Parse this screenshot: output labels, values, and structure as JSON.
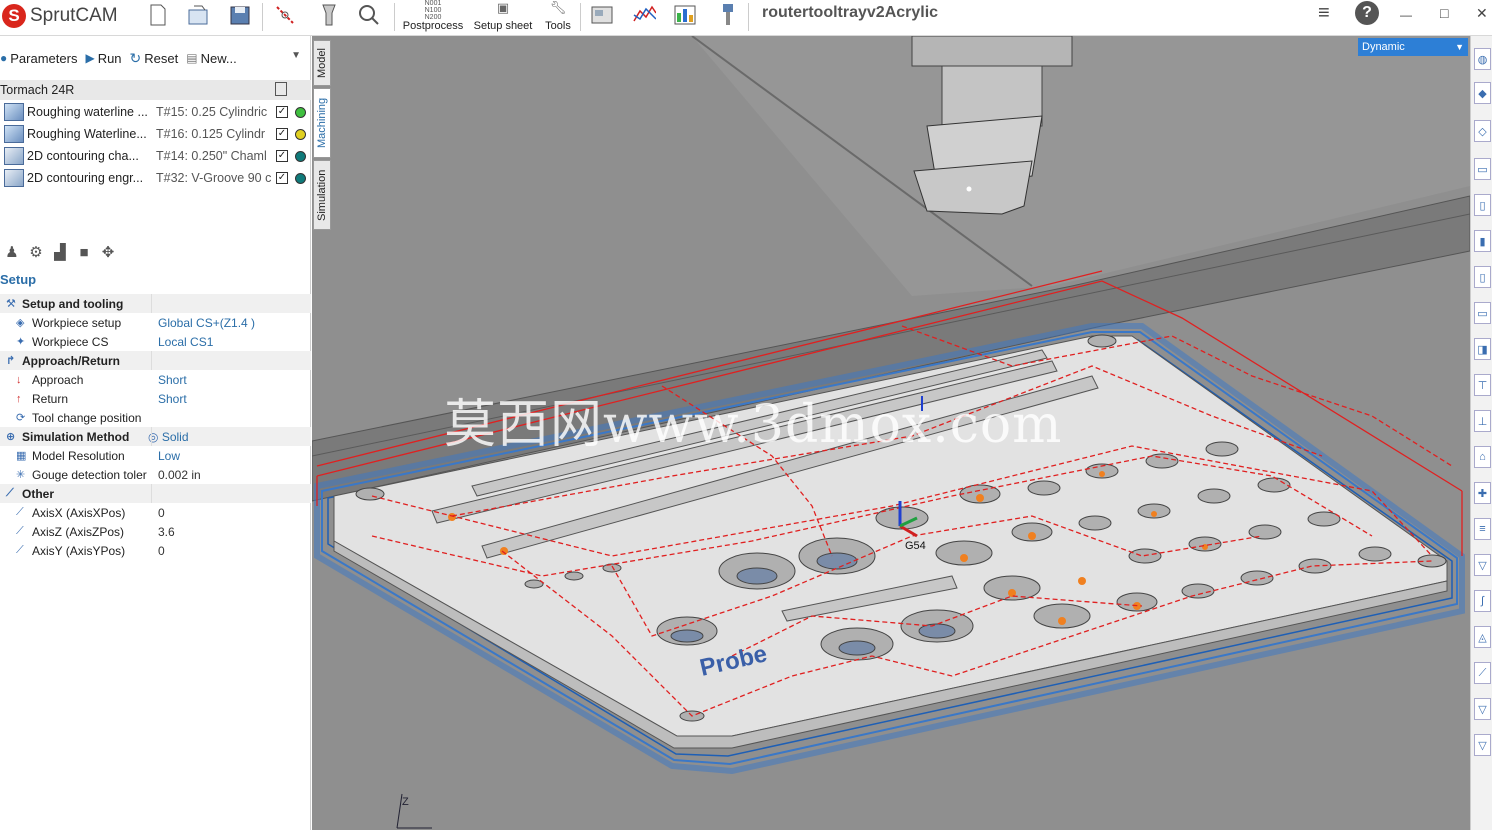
{
  "app": {
    "name": "SprutCAM",
    "logo_letter": "S",
    "project_name": "routertooltrayv2Acrylic"
  },
  "ribbon": {
    "icons": [
      "new-file-icon",
      "open-file-icon",
      "save-icon",
      "cut-icon",
      "measure-icon",
      "zoom-icon"
    ],
    "postprocess_label": "Postprocess",
    "setup_sheet_label": "Setup sheet",
    "tools_label": "Tools",
    "nc_code": [
      "N001",
      "N100",
      "N200"
    ]
  },
  "window_controls": {
    "menu": "≡",
    "help": "?",
    "minimize": "—",
    "maximize": "□",
    "close": "✕"
  },
  "operations_toolbar": {
    "parameters_label": "Parameters",
    "run_label": "Run",
    "reset_label": "Reset",
    "new_label": "New..."
  },
  "machine_name": "Tormach 24R",
  "operations": [
    {
      "name": "Roughing waterline ...",
      "tool": "T#15: 0.25 Cylindric",
      "status_color": "#3fbf3f"
    },
    {
      "name": "Roughing Waterline...",
      "tool": "T#16: 0.125 Cylindr",
      "status_color": "#e0d020"
    },
    {
      "name": "2D contouring cha...",
      "tool": "T#14: 0.250\" Chaml",
      "status_color": "#0f7a7a"
    },
    {
      "name": "2D contouring engr...",
      "tool": "T#32: V-Groove 90 c",
      "status_color": "#0f7a7a"
    }
  ],
  "side_tabs": {
    "model": "Model",
    "machining": "Machining",
    "simulation": "Simulation"
  },
  "setup": {
    "title": "Setup",
    "rows": [
      {
        "kind": "group",
        "label": "Setup and tooling",
        "value": ""
      },
      {
        "kind": "item",
        "label": "Workpiece setup",
        "value": "Global CS+(Z1.4 )"
      },
      {
        "kind": "item",
        "label": "Workpiece CS",
        "value": "Local CS1"
      },
      {
        "kind": "group",
        "label": "Approach/Return",
        "value": ""
      },
      {
        "kind": "item",
        "label": "Approach",
        "value": "Short"
      },
      {
        "kind": "item",
        "label": "Return",
        "value": "Short"
      },
      {
        "kind": "item",
        "label": "Tool change position",
        "value": ""
      },
      {
        "kind": "group",
        "label": "Simulation Method",
        "value": "Solid"
      },
      {
        "kind": "item",
        "label": "Model Resolution",
        "value": "Low"
      },
      {
        "kind": "item",
        "label": "Gouge detection toler",
        "value": "0.002 in"
      },
      {
        "kind": "group",
        "label": "Other",
        "value": ""
      },
      {
        "kind": "item",
        "label": "AxisX (AxisXPos)",
        "value": "0"
      },
      {
        "kind": "item",
        "label": "AxisZ (AxisZPos)",
        "value": "3.6"
      },
      {
        "kind": "item",
        "label": "AxisY (AxisYPos)",
        "value": "0"
      }
    ]
  },
  "viewport": {
    "view_mode": "Dynamic",
    "watermark": "莫西网www.3dmox.com",
    "engraving_text": "Probe",
    "origin_label": "G54",
    "axis_label": "Z"
  },
  "colors": {
    "accent": "#2b6ea8",
    "toolpath": "#e02020",
    "stock": "#3a78c8"
  }
}
